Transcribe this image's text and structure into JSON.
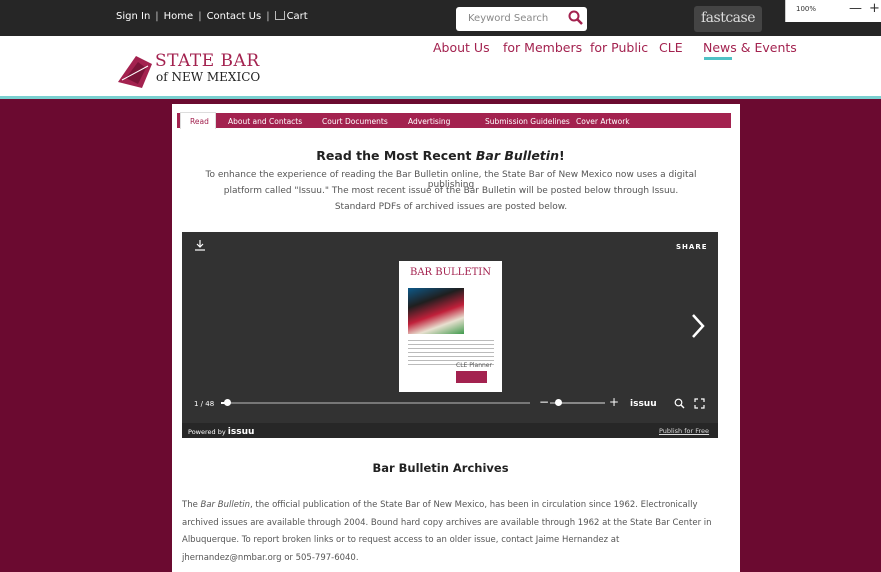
{
  "topbar": {
    "links": [
      "Sign In",
      "Home",
      "Contact Us",
      "Cart"
    ],
    "search_placeholder": "Keyword Search",
    "fastcase": "fastcase",
    "zoom": "100%",
    "zoom_minus": "—",
    "zoom_plus": "+"
  },
  "logo": {
    "line1": "STATE BAR",
    "line2": "of NEW MEXICO"
  },
  "nav": [
    "About Us",
    "for Members",
    "for Public",
    "CLE",
    "News & Events"
  ],
  "tabs": [
    "Read",
    "About and Contacts",
    "Court Documents",
    "Advertising",
    "Submission Guidelines",
    "Cover Artwork"
  ],
  "heading": {
    "prefix": "Read the Most Recent ",
    "em": "Bar Bulletin",
    "suffix": "!"
  },
  "intro": [
    "To enhance the experience of reading the Bar Bulletin online, the State Bar of New Mexico now uses a digital publishing",
    "platform called \"Issuu.\" The most recent issue of the Bar Bulletin will be posted below through Issuu.",
    "Standard PDFs of archived issues are posted below."
  ],
  "viewer": {
    "share": "SHARE",
    "cover_title": "BAR BULLETIN",
    "cover_badge": "CLE Planner",
    "page_indicator": "1 / 48",
    "progress": 0.02,
    "brand": "issuu",
    "powered_by": "Powered by",
    "publish": "Publish for Free"
  },
  "archives": {
    "title": "Bar Bulletin Archives",
    "em": "Bar Bulletin",
    "lead": "The ",
    "line1_rest": ", the official publication of the State Bar of New Mexico, has been in circulation since 1962. Electronically",
    "line2": "archived issues are available through 2004. Bound hard copy archives are available through 1962 at the State Bar Center in",
    "line3": "Albuquerque. To report broken links or to request access to an older issue, contact Jaime Hernandez at",
    "line4": "jhernandez@nmbar.org or 505-797-6040."
  }
}
